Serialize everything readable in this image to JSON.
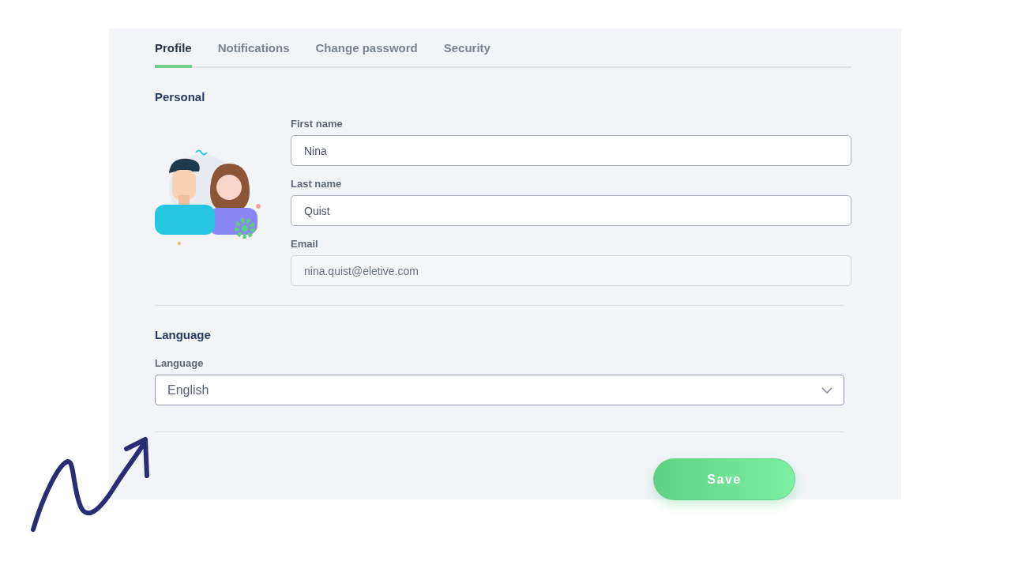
{
  "tabs": [
    {
      "label": "Profile",
      "selected": true
    },
    {
      "label": "Notifications",
      "selected": false
    },
    {
      "label": "Change password",
      "selected": false
    },
    {
      "label": "Security",
      "selected": false
    }
  ],
  "personal": {
    "heading": "Personal",
    "fields": [
      {
        "label": "First name",
        "value": "Nina",
        "disabled": false
      },
      {
        "label": "Last name",
        "value": "Quist",
        "disabled": false
      },
      {
        "label": "Email",
        "value": "nina.quist@eletive.com",
        "disabled": true
      }
    ]
  },
  "language": {
    "heading": "Language",
    "label": "Language",
    "value": "English"
  },
  "save_button": "Save"
}
